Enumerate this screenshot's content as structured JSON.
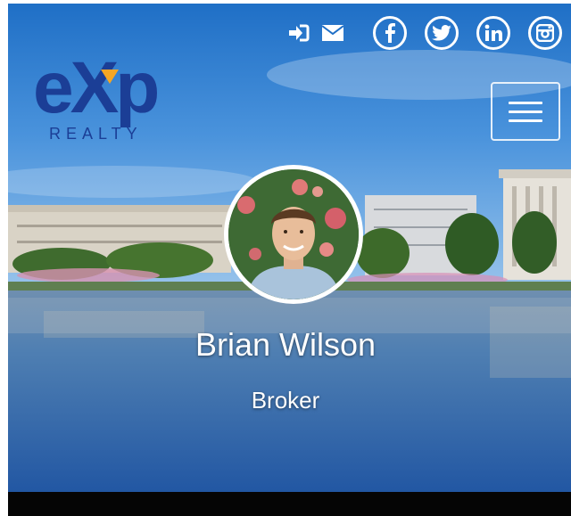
{
  "brand": {
    "logo_main": "eXp",
    "logo_sub": "REALTY",
    "logo_color": "#1b3e96",
    "accent_color": "#f5a623"
  },
  "header": {
    "icons": [
      "sign-in-icon",
      "envelope-icon"
    ],
    "social": [
      "facebook-icon",
      "twitter-icon",
      "linkedin-icon",
      "instagram-icon"
    ],
    "menu_icon": "hamburger-icon"
  },
  "profile": {
    "name": "Brian Wilson",
    "title": "Broker"
  }
}
